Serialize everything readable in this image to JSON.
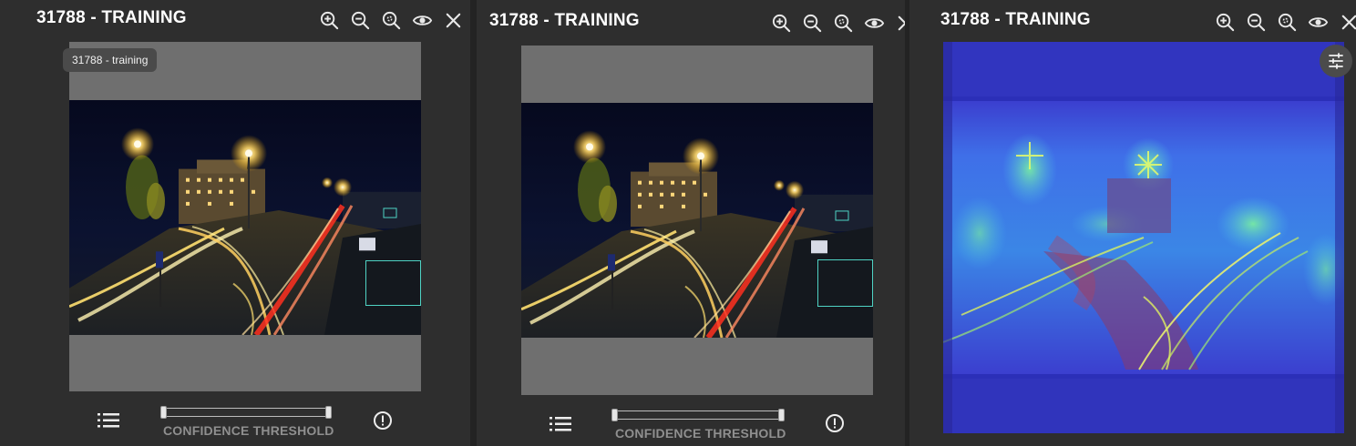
{
  "panels": [
    {
      "title": "31788 - TRAINING",
      "tooltip": "31788 - training",
      "confidence_label": "CONFIDENCE THRESHOLD",
      "confidence_range": [
        0,
        1
      ],
      "view": "detections",
      "boxes": 2
    },
    {
      "title": "31788 - TRAINING",
      "confidence_label": "CONFIDENCE THRESHOLD",
      "confidence_range": [
        0,
        1
      ],
      "view": "detections",
      "boxes": 1
    },
    {
      "title": "31788 - TRAINING",
      "view": "heatmap"
    }
  ],
  "icons": {
    "zoom_in": "zoom-in-icon",
    "zoom_out": "zoom-out-icon",
    "zoom_fit": "zoom-fit-icon",
    "visibility": "eye-icon",
    "close": "close-icon",
    "list": "list-icon",
    "info": "info-icon",
    "settings": "tune-icon"
  },
  "colors": {
    "panel_bg": "#2e2e2e",
    "canvas_bg": "#6f6f6f",
    "bbox": "#4fd3c4",
    "label_gray": "#8f8f8f"
  }
}
